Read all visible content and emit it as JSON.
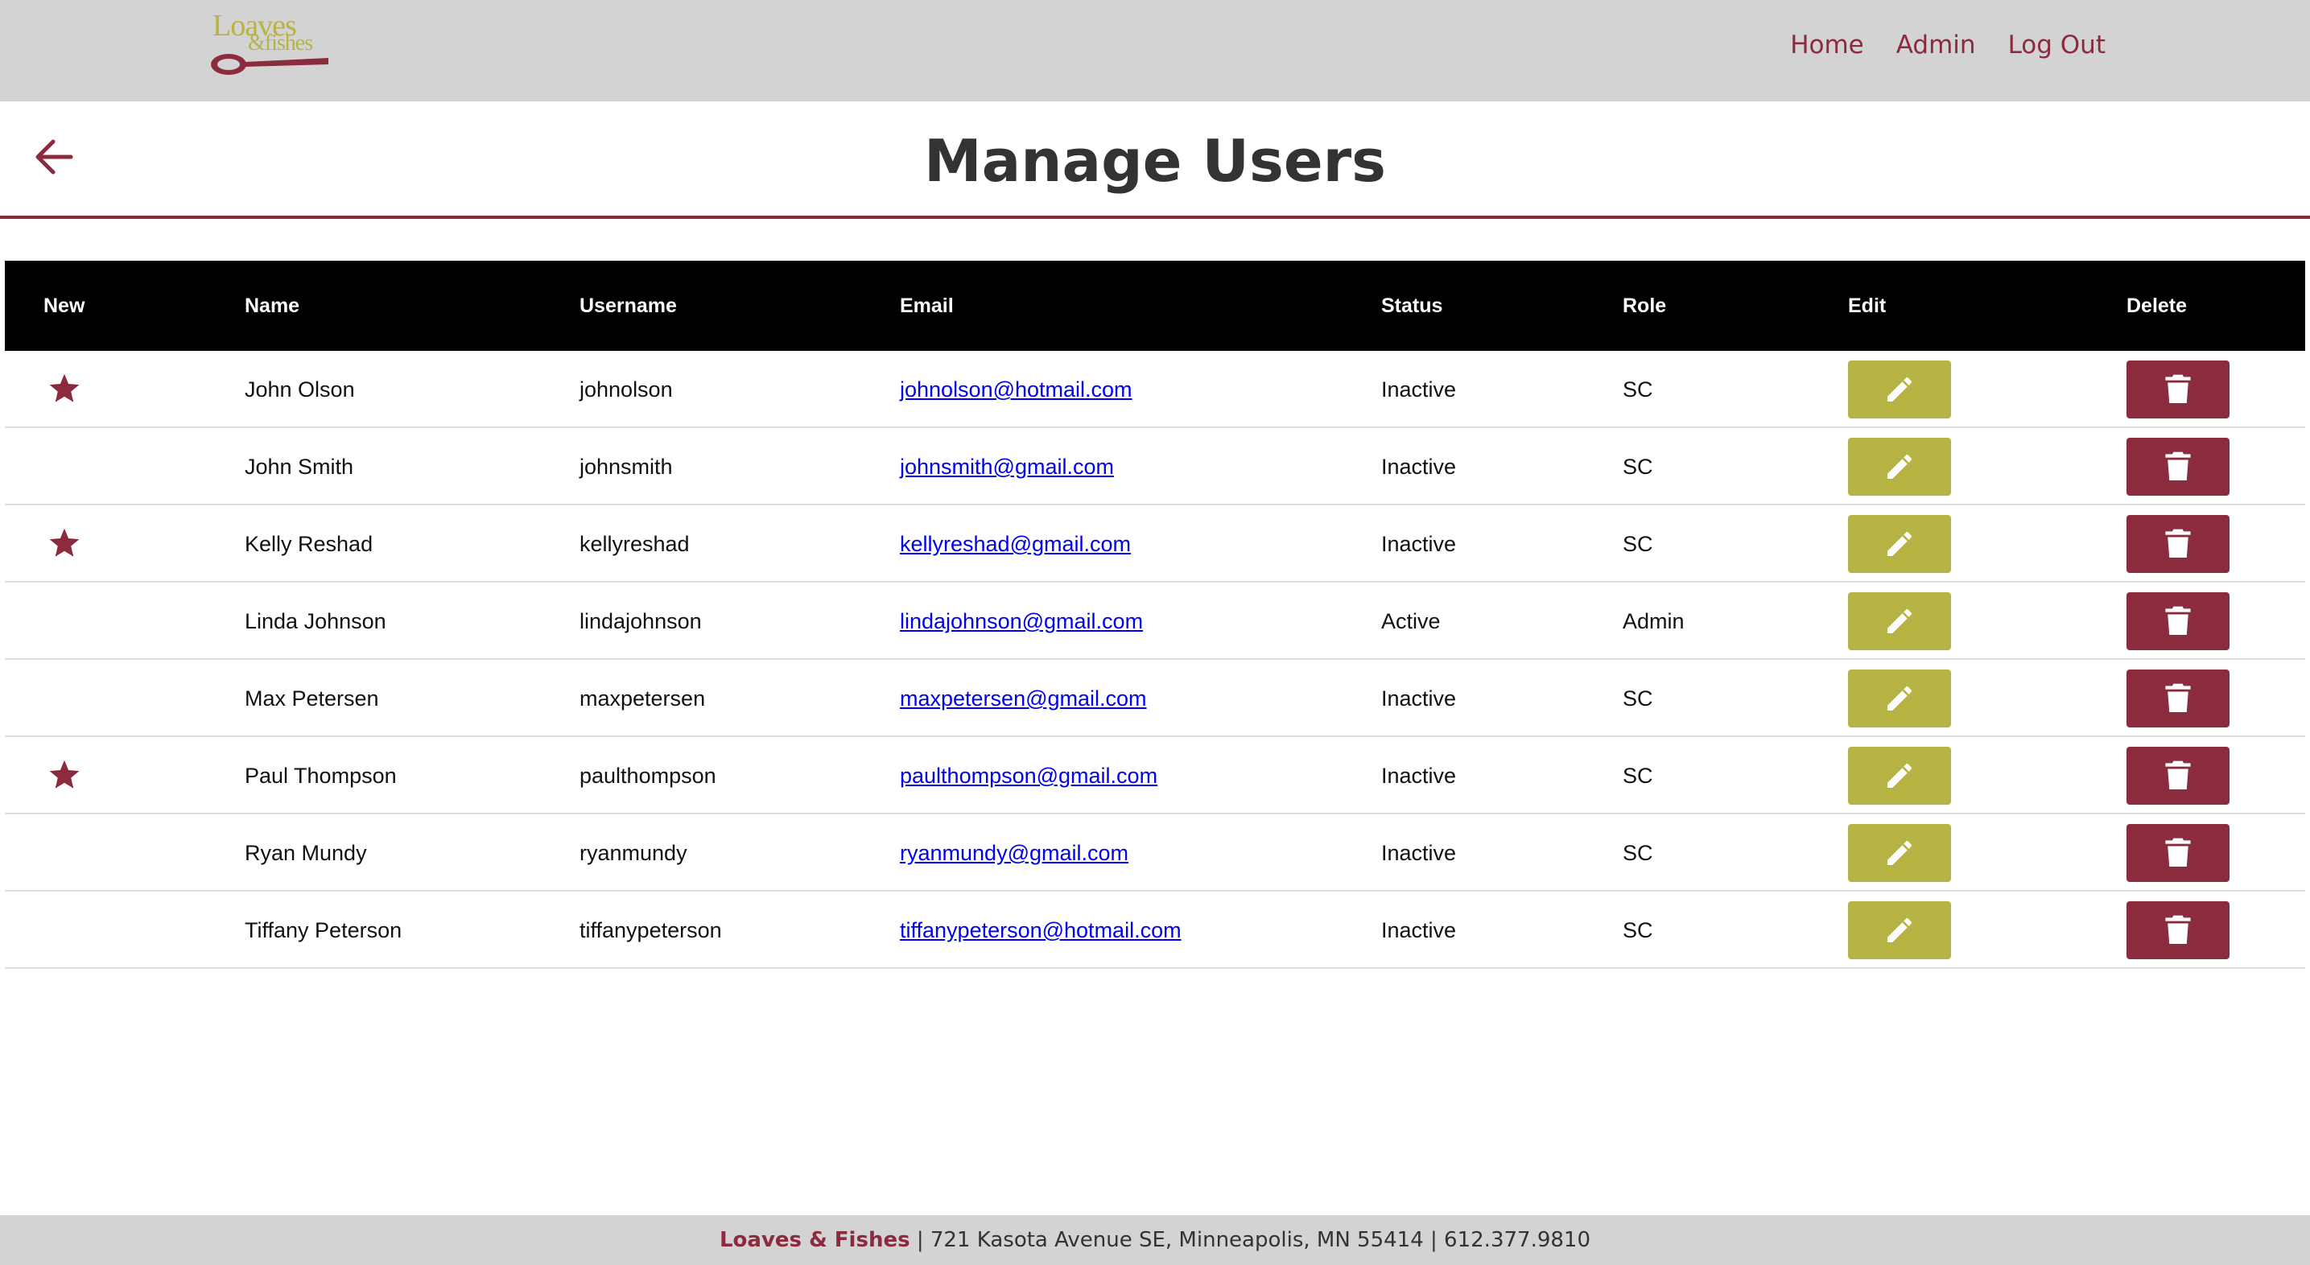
{
  "header": {
    "logo_main": "Loaves",
    "logo_sub": "&fishes",
    "nav": [
      {
        "label": "Home"
      },
      {
        "label": "Admin"
      },
      {
        "label": "Log Out"
      }
    ]
  },
  "page": {
    "title": "Manage Users"
  },
  "table": {
    "headers": [
      "New",
      "Name",
      "Username",
      "Email",
      "Status",
      "Role",
      "Edit",
      "Delete"
    ],
    "rows": [
      {
        "new": true,
        "name": "John Olson",
        "username": "johnolson",
        "email": "johnolson@hotmail.com",
        "status": "Inactive",
        "role": "SC"
      },
      {
        "new": false,
        "name": "John Smith",
        "username": "johnsmith",
        "email": "johnsmith@gmail.com",
        "status": "Inactive",
        "role": "SC"
      },
      {
        "new": true,
        "name": "Kelly Reshad",
        "username": "kellyreshad",
        "email": "kellyreshad@gmail.com",
        "status": "Inactive",
        "role": "SC"
      },
      {
        "new": false,
        "name": "Linda Johnson",
        "username": "lindajohnson",
        "email": "lindajohnson@gmail.com",
        "status": "Active",
        "role": "Admin"
      },
      {
        "new": false,
        "name": "Max Petersen",
        "username": "maxpetersen",
        "email": "maxpetersen@gmail.com",
        "status": "Inactive",
        "role": "SC"
      },
      {
        "new": true,
        "name": "Paul Thompson",
        "username": "paulthompson",
        "email": "paulthompson@gmail.com",
        "status": "Inactive",
        "role": "SC"
      },
      {
        "new": false,
        "name": "Ryan Mundy",
        "username": "ryanmundy",
        "email": "ryanmundy@gmail.com",
        "status": "Inactive",
        "role": "SC"
      },
      {
        "new": false,
        "name": "Tiffany Peterson",
        "username": "tiffanypeterson",
        "email": "tiffanypeterson@hotmail.com",
        "status": "Inactive",
        "role": "SC"
      }
    ]
  },
  "icons": {
    "back": "arrow-left-icon",
    "new": "star-icon",
    "edit": "pencil-icon",
    "delete": "trash-icon"
  },
  "colors": {
    "brand": "#8c2a3e",
    "accent": "#b7b445",
    "header_bg": "#d3d3d3",
    "table_header_bg": "#000000"
  },
  "footer": {
    "brand": "Loaves & Fishes",
    "address": " | 721 Kasota Avenue SE, Minneapolis, MN 55414 | 612.377.9810"
  }
}
